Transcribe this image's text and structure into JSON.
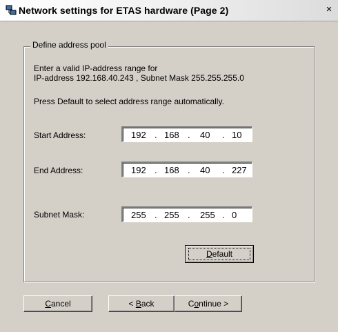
{
  "window": {
    "title": "Network settings for ETAS hardware (Page 2)",
    "close_glyph": "×",
    "icon": "network-icon"
  },
  "group": {
    "legend": "Define address pool",
    "instruction_line1": "Enter a valid IP-address range for",
    "instruction_line2": "IP-address 192.168.40.243 , Subnet Mask 255.255.255.0",
    "default_hint": "Press Default to select address range automatically."
  },
  "fields": {
    "start": {
      "label": "Start Address:",
      "octets": [
        "192",
        "168",
        "40",
        "10"
      ]
    },
    "end": {
      "label": "End Address:",
      "octets": [
        "192",
        "168",
        "40",
        "227"
      ]
    },
    "mask": {
      "label": "Subnet Mask:",
      "octets": [
        "255",
        "255",
        "255",
        "0"
      ]
    },
    "separator": "."
  },
  "buttons": {
    "default": {
      "mnemonic": "D",
      "rest": "efault"
    },
    "cancel": {
      "mnemonic": "C",
      "rest": "ancel"
    },
    "back": {
      "prefix": "< ",
      "mnemonic": "B",
      "rest": "ack"
    },
    "continue": {
      "prefix": "C",
      "mnemonic": "o",
      "rest": "ntinue >"
    }
  }
}
